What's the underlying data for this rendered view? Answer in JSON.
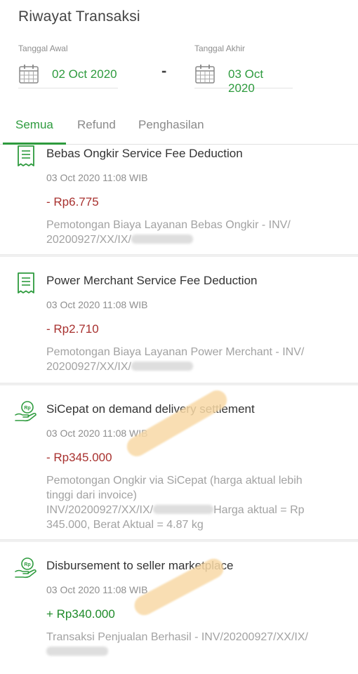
{
  "header": {
    "title": "Riwayat Transaksi"
  },
  "date_range": {
    "start": {
      "label": "Tanggal Awal",
      "value": "02 Oct 2020",
      "icon": "calendar-icon"
    },
    "separator": "-",
    "end": {
      "label": "Tanggal Akhir",
      "value": "03 Oct 2020",
      "icon": "calendar-icon"
    }
  },
  "tabs": [
    {
      "label": "Semua",
      "active": true
    },
    {
      "label": "Refund",
      "active": false
    },
    {
      "label": "Penghasilan",
      "active": false
    }
  ],
  "transactions": [
    {
      "icon": "receipt-icon",
      "title": "Bebas Ongkir Service Fee Deduction",
      "time": "03 Oct 2020 11:08 WIB",
      "amount": "- Rp6.775",
      "sign": "negative",
      "desc_line1": "Pemotongan Biaya Layanan Bebas Ongkir - INV/",
      "desc_line2": "20200927/XX/IX/"
    },
    {
      "icon": "receipt-icon",
      "title": "Power Merchant Service Fee Deduction",
      "time": "03 Oct 2020 11:08 WIB",
      "amount": "- Rp2.710",
      "sign": "negative",
      "desc_line1": "Pemotongan Biaya Layanan Power Merchant - INV/",
      "desc_line2": "20200927/XX/IX/"
    },
    {
      "icon": "money-hand-icon",
      "title": "SiCepat on demand delivery settlement",
      "time": "03 Oct 2020 11:08 WIB",
      "amount": "- Rp345.000",
      "sign": "negative",
      "desc_line1": "Pemotongan Ongkir via SiCepat (harga aktual lebih",
      "desc_line2": "tinggi dari invoice)",
      "desc_line3a": "INV/20200927/XX/IX/",
      "desc_line3b": "Harga aktual = Rp",
      "desc_line4": "345.000, Berat Aktual = 4.87 kg"
    },
    {
      "icon": "money-hand-icon",
      "title": "Disbursement to seller marketplace",
      "time": "03 Oct 2020 11:08 WIB",
      "amount": "+ Rp340.000",
      "sign": "positive",
      "desc_line1": "Transaksi Penjualan Berhasil - INV/20200927/XX/IX/"
    }
  ],
  "colors": {
    "accent": "#2e9b3e",
    "negative": "#a8312f",
    "positive": "#1f8b2a"
  }
}
